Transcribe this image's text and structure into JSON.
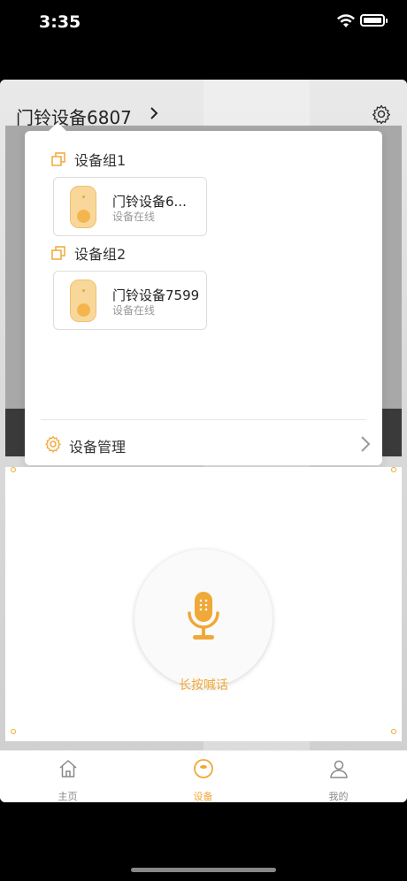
{
  "status_bar": {
    "time": "3:35"
  },
  "header": {
    "device_title": "门铃设备6807"
  },
  "dropdown": {
    "groups": [
      {
        "label": "设备组1",
        "device": {
          "name": "门铃设备6...",
          "status": "设备在线"
        }
      },
      {
        "label": "设备组2",
        "device": {
          "name": "门铃设备7599",
          "status": "设备在线"
        }
      }
    ],
    "manage_label": "设备管理"
  },
  "talk": {
    "label": "长按喊话"
  },
  "tabs": [
    {
      "label": "主页",
      "icon": "home-icon",
      "active": false
    },
    {
      "label": "设备",
      "icon": "device-icon",
      "active": true
    },
    {
      "label": "我的",
      "icon": "profile-icon",
      "active": false
    }
  ],
  "colors": {
    "accent": "#f0a838",
    "device_thumb": "#f8d79a"
  }
}
